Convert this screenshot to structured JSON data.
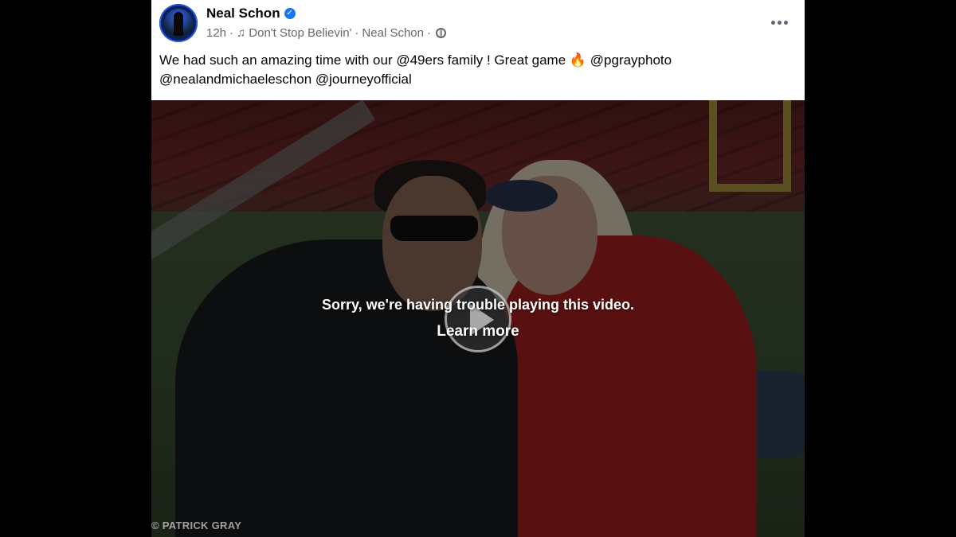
{
  "post": {
    "author_name": "Neal Schon",
    "verified_badge": "✓",
    "timestamp": "12h",
    "separator": "·",
    "music_icon": "music-note-icon",
    "song": "Don't Stop Believin'",
    "song_artist": "Neal Schon",
    "audience_icon": "globe-icon",
    "more_icon": "more-options-icon",
    "caption_line1": "We had such an amazing time with our @49ers family ! Great game 🔥 @pgrayphoto",
    "caption_line2": "@nealandmichaeleschon @journeyofficial"
  },
  "video": {
    "error_message": "Sorry, we're having trouble playing this video.",
    "learn_more": "Learn more",
    "watermark": "© PATRICK GRAY"
  },
  "colors": {
    "page_background": "#000000",
    "card_background": "#ffffff",
    "verified_blue": "#1877f2",
    "meta_gray": "#65676b"
  }
}
